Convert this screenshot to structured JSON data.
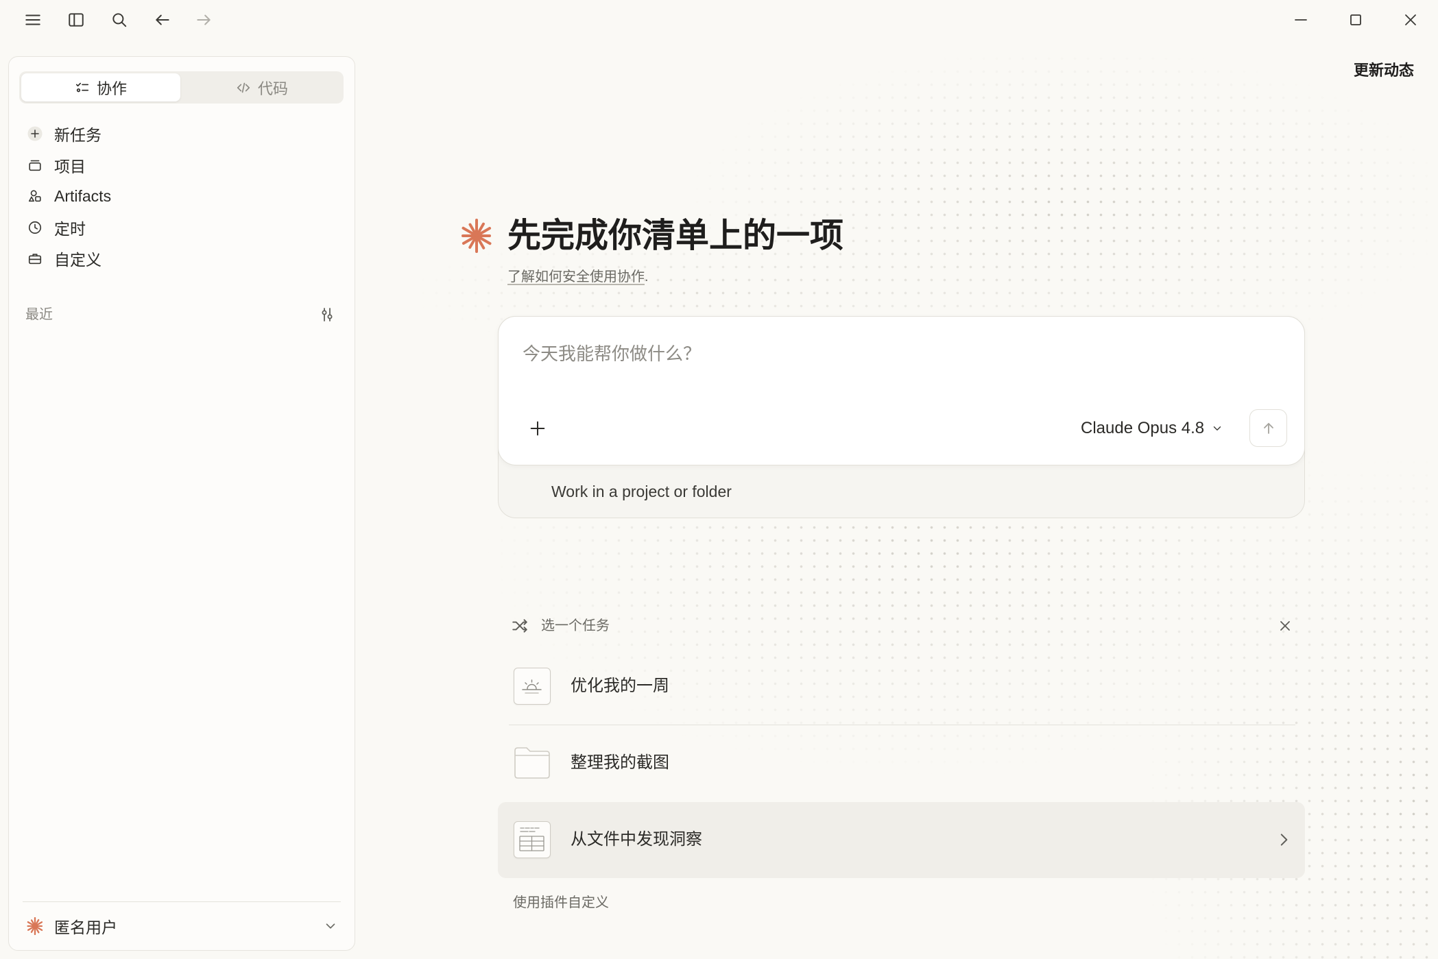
{
  "titlebar": {
    "left_icons": [
      "hamburger-menu-icon",
      "sidebar-toggle-icon",
      "search-icon",
      "arrow-left-icon",
      "arrow-right-icon"
    ],
    "window_controls": [
      "minimize-icon",
      "maximize-icon",
      "close-icon"
    ]
  },
  "sidebar": {
    "tabs": [
      {
        "label": "协作",
        "icon": "checklist-icon",
        "active": true
      },
      {
        "label": "代码",
        "icon": "code-icon",
        "active": false
      }
    ],
    "nav": [
      {
        "label": "新任务",
        "icon": "plus-circle-icon"
      },
      {
        "label": "项目",
        "icon": "project-tray-icon"
      },
      {
        "label": "Artifacts",
        "icon": "shapes-icon"
      },
      {
        "label": "定时",
        "icon": "clock-icon"
      },
      {
        "label": "自定义",
        "icon": "briefcase-icon"
      }
    ],
    "recent": {
      "label": "最近",
      "icon": "filter-sliders-icon"
    },
    "user": {
      "name": "匿名用户",
      "avatar_icon": "claude-star-icon",
      "menu_icon": "chevron-down-icon"
    }
  },
  "header": {
    "updates_label": "更新动态"
  },
  "hero": {
    "icon": "claude-star-icon",
    "title": "先完成你清单上的一项",
    "learn_link": "了解如何安全使用协作",
    "learn_suffix": "."
  },
  "composer": {
    "placeholder": "今天我能帮你做什么？",
    "attach_icon": "plus-icon",
    "model": "Claude Opus 4.8",
    "model_icon": "chevron-down-icon",
    "send_icon": "arrow-up-icon",
    "project_label": "Work in a project or folder"
  },
  "tasks": {
    "header_icon": "shuffle-icon",
    "header_label": "选一个任务",
    "dismiss_icon": "close-icon",
    "items": [
      {
        "label": "优化我的一周",
        "icon": "sunrise-calendar-icon",
        "highlighted": false
      },
      {
        "label": "整理我的截图",
        "icon": "folder-icon",
        "highlighted": false
      },
      {
        "label": "从文件中发现洞察",
        "icon": "spreadsheet-icon",
        "highlighted": true
      }
    ],
    "customize_link": "使用插件自定义"
  },
  "colors": {
    "accent": "#d97757",
    "background": "#faf9f5",
    "sidebar": "#fdfcfa",
    "text": "#1f1e1d",
    "muted": "#6b6a64",
    "highlight": "#f0eee9"
  }
}
